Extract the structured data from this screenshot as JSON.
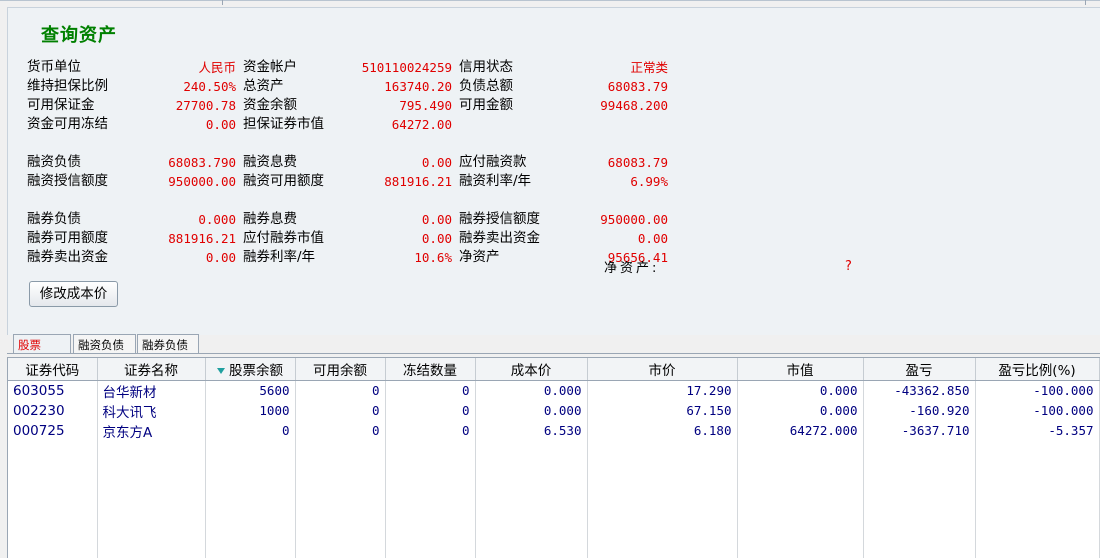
{
  "title": "查询资产",
  "summary": {
    "row1": {
      "l1": "货币单位",
      "v1": "人民币",
      "l2": "资金帐户",
      "v2": "510110024259",
      "l3": "信用状态",
      "v3": "正常类"
    },
    "row2": {
      "l1": "维持担保比例",
      "v1": "240.50%",
      "l2": "总资产",
      "v2": "163740.20",
      "l3": "负债总额",
      "v3": "68083.79"
    },
    "row3": {
      "l1": "可用保证金",
      "v1": "27700.78",
      "l2": "资金余额",
      "v2": "795.490",
      "l3": "可用金额",
      "v3": "99468.200"
    },
    "row4": {
      "l1": "资金可用冻结",
      "v1": "0.00",
      "l2": "担保证券市值",
      "v2": "64272.00"
    },
    "row5": {
      "l1": "融资负债",
      "v1": "68083.790",
      "l2": "融资息费",
      "v2": "0.00",
      "l3": "应付融资款",
      "v3": "68083.79"
    },
    "row6": {
      "l1": "融资授信额度",
      "v1": "950000.00",
      "l2": "融资可用额度",
      "v2": "881916.21",
      "l3": "融资利率/年",
      "v3": "6.99%"
    },
    "row7": {
      "l1": "融券负债",
      "v1": "0.000",
      "l2": "融券息费",
      "v2": "0.00",
      "l3": "融券授信额度",
      "v3": "950000.00"
    },
    "row8": {
      "l1": "融券可用额度",
      "v1": "881916.21",
      "l2": "应付融券市值",
      "v2": "0.00",
      "l3": "融券卖出资金",
      "v3": "0.00"
    },
    "row9": {
      "l1": "融券卖出资金",
      "v1": "0.00",
      "l2": "融券利率/年",
      "v2": "10.6%",
      "l3": "净资产",
      "v3": "95656.41"
    },
    "overlap_label": "净资产:",
    "overlap_value": "?"
  },
  "edit_cost_button": "修改成本价",
  "tabs": [
    "股票",
    "融资负债",
    "融券负债"
  ],
  "columns": [
    "证券代码",
    "证券名称",
    "股票余额",
    "可用余额",
    "冻结数量",
    "成本价",
    "市价",
    "市值",
    "盈亏",
    "盈亏比例(%)"
  ],
  "rows": [
    [
      "603055",
      "台华新材",
      "5600",
      "0",
      "0",
      "0.000",
      "17.290",
      "0.000",
      "-43362.850",
      "-100.000"
    ],
    [
      "002230",
      "科大讯飞",
      "1000",
      "0",
      "0",
      "0.000",
      "67.150",
      "0.000",
      "-160.920",
      "-100.000"
    ],
    [
      "000725",
      "京东方A",
      "0",
      "0",
      "0",
      "6.530",
      "6.180",
      "64272.000",
      "-3637.710",
      "-5.357"
    ]
  ],
  "colors": {
    "title": "#008000",
    "value": "#e00000",
    "cell": "#000080",
    "active_tab": "#e00000"
  },
  "icons": {
    "sort": "sort-descending-icon"
  }
}
